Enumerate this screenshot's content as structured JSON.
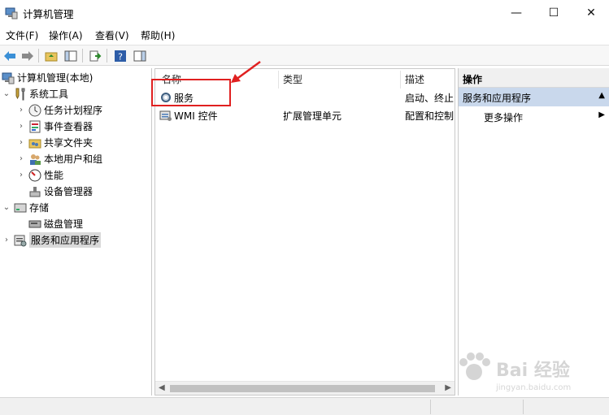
{
  "window": {
    "title": "计算机管理",
    "minimize": "—",
    "maximize": "☐",
    "close": "✕"
  },
  "menu": [
    "文件(F)",
    "操作(A)",
    "查看(V)",
    "帮助(H)"
  ],
  "tree": {
    "root": "计算机管理(本地)",
    "system_tools": "系统工具",
    "task_scheduler": "任务计划程序",
    "event_viewer": "事件查看器",
    "shared_folders": "共享文件夹",
    "local_users": "本地用户和组",
    "performance": "性能",
    "device_manager": "设备管理器",
    "storage": "存储",
    "disk_management": "磁盘管理",
    "services_apps": "服务和应用程序"
  },
  "list": {
    "columns": [
      "名称",
      "类型",
      "描述"
    ],
    "rows": [
      {
        "name": "服务",
        "type": "",
        "desc": "启动、终止"
      },
      {
        "name": "WMI 控件",
        "type": "扩展管理单元",
        "desc": "配置和控制"
      }
    ]
  },
  "actions": {
    "title": "操作",
    "section": "服务和应用程序",
    "more": "更多操作"
  },
  "watermark": {
    "brand": "Bai 经验",
    "url": "jingyan.baidu.com"
  },
  "colors": {
    "highlight_red": "#e02020",
    "selection_blue": "#c9d8ec"
  }
}
